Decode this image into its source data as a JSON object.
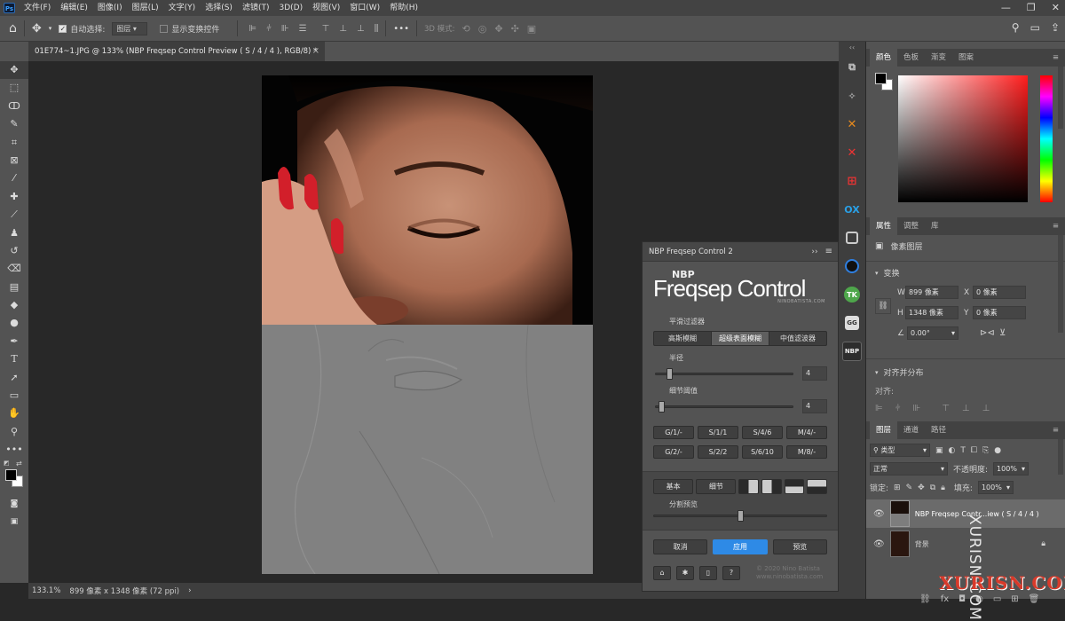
{
  "menubar": {
    "logo": "Ps",
    "items": [
      "文件(F)",
      "编辑(E)",
      "图像(I)",
      "图层(L)",
      "文字(Y)",
      "选择(S)",
      "滤镜(T)",
      "3D(D)",
      "视图(V)",
      "窗口(W)",
      "帮助(H)"
    ],
    "window_controls": [
      "—",
      "❐",
      "✕"
    ]
  },
  "options": {
    "auto_select_label": "自动选择:",
    "auto_select_value": "图层",
    "show_transform_label": "显示变换控件",
    "more": "•••",
    "mode_3d_label": "3D 模式:"
  },
  "document": {
    "tab_title": "01E774~1.JPG @ 133% (NBP Freqsep Control Preview ( S / 4 / 4 ), RGB/8) *",
    "close": "×"
  },
  "status": {
    "zoom": "133.1%",
    "info": "899 像素 x 1348 像素 (72 ppi)",
    "arrow": "›"
  },
  "color_panel": {
    "tabs": [
      "颜色",
      "色板",
      "渐变",
      "图案"
    ],
    "active_tab": "颜色",
    "hue": "#ff0000",
    "foreground": "#000000",
    "background": "#ffffff"
  },
  "properties_panel": {
    "tabs": [
      "属性",
      "调整",
      "库"
    ],
    "active_tab": "属性",
    "layer_type": "像素图层",
    "transform_heading": "变换",
    "w_label": "W",
    "w_value": "899 像素",
    "h_label": "H",
    "h_value": "1348 像素",
    "x_label": "X",
    "x_value": "0 像素",
    "y_label": "Y",
    "y_value": "0 像素",
    "angle_value": "0.00°",
    "align_heading": "对齐并分布",
    "align_label": "对齐:"
  },
  "layers_panel": {
    "tabs": [
      "图层",
      "通道",
      "路径"
    ],
    "active_tab": "图层",
    "filter_kind": "类型",
    "blend_mode": "正常",
    "opacity_label": "不透明度:",
    "opacity_value": "100%",
    "lock_label": "锁定:",
    "fill_label": "填充:",
    "fill_value": "100%",
    "layers": [
      {
        "name": "NBP Freqsep Contr...iew ( S / 4 / 4 )",
        "selected": true
      },
      {
        "name": "背景",
        "selected": false
      }
    ]
  },
  "freqsep": {
    "panel_title": "NBP Freqsep Control 2",
    "logo_small": "NBP",
    "logo_main": "Freqsep Control",
    "logo_url": "NINOBATISTA.COM",
    "smoothing_label": "平滑过滤器",
    "filter_options": [
      "高斯模糊",
      "超级表面模糊",
      "中值滤波器"
    ],
    "active_filter": "超级表面模糊",
    "radius_label": "半径",
    "radius_value": "4",
    "radius_fraction": 0.08,
    "threshold_label": "细节阈值",
    "threshold_value": "4",
    "threshold_fraction": 0.02,
    "presets_row1": [
      "G/1/-",
      "S/1/1",
      "S/4/6",
      "M/4/-"
    ],
    "presets_row2": [
      "G/2/-",
      "S/2/2",
      "S/6/10",
      "M/8/-"
    ],
    "view_tabs": [
      "基本",
      "细节"
    ],
    "split_label": "分割预览",
    "split_fraction": 0.5,
    "cancel_label": "取消",
    "apply_label": "应用",
    "preview_label": "预览",
    "copyright": "© 2020 Nino Batista",
    "website": "www.ninobatista.com",
    "accent": "#2e8ae6"
  },
  "watermark": {
    "vertical": "XURISN.COM",
    "bottom": "XURISN.COM"
  }
}
